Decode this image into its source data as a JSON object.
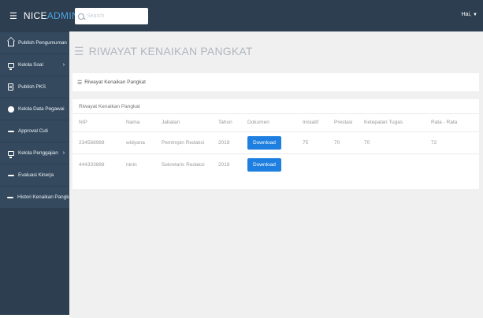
{
  "brand": {
    "part1": "NICE",
    "part2": "ADMIN"
  },
  "search": {
    "placeholder": "Search"
  },
  "user": {
    "label": "Hai,"
  },
  "sidebar": {
    "items": [
      {
        "label": "Publish Pengumuman",
        "icon": "home-icon"
      },
      {
        "label": "Kelola Soal",
        "icon": "monitor-icon",
        "has_submenu": true
      },
      {
        "label": "Publish PKS",
        "icon": "doc-icon"
      },
      {
        "label": "Kelola Data Pegawai",
        "icon": "circle-icon"
      },
      {
        "label": "Approval Cuti",
        "icon": "bar-icon"
      },
      {
        "label": "Kelola Penggajian",
        "icon": "monitor-icon",
        "has_submenu": true
      },
      {
        "label": "Evaluasi Kinerja",
        "icon": "bar-icon"
      },
      {
        "label": "Histori Kenaikan Pangkat",
        "icon": "bar-icon"
      }
    ]
  },
  "page": {
    "title": "RIWAYAT KENAIKAN PANGKAT",
    "breadcrumb": "Riwayat Kenaikan Pangkat",
    "panel_title": "Riwayat Kenaikan Pangkat"
  },
  "table": {
    "headers": [
      "NIP",
      "Nama",
      "Jabatan",
      "Tahun",
      "Dokumen",
      "Inisiatif",
      "Prestasi",
      "Ketepatan Tugas",
      "Rata - Rata"
    ],
    "rows": [
      {
        "nip": "234568988",
        "nama": "widyana",
        "jabatan": "Pemimpin Redaksi",
        "tahun": "2018",
        "dokumen": "Download",
        "inisiatif": "75",
        "prestasi": "70",
        "ketepatan": "70",
        "rata": "72"
      },
      {
        "nip": "444333888",
        "nama": "ninin",
        "jabatan": "Sekretaris Redaksi",
        "tahun": "2018",
        "dokumen": "Download",
        "inisiatif": "",
        "prestasi": "",
        "ketepatan": "",
        "rata": ""
      }
    ]
  },
  "colors": {
    "topbar": "#2c3e50",
    "sidebar_item": "#34495e",
    "brand_accent": "#4fa3e0",
    "button": "#1e7fe0"
  }
}
